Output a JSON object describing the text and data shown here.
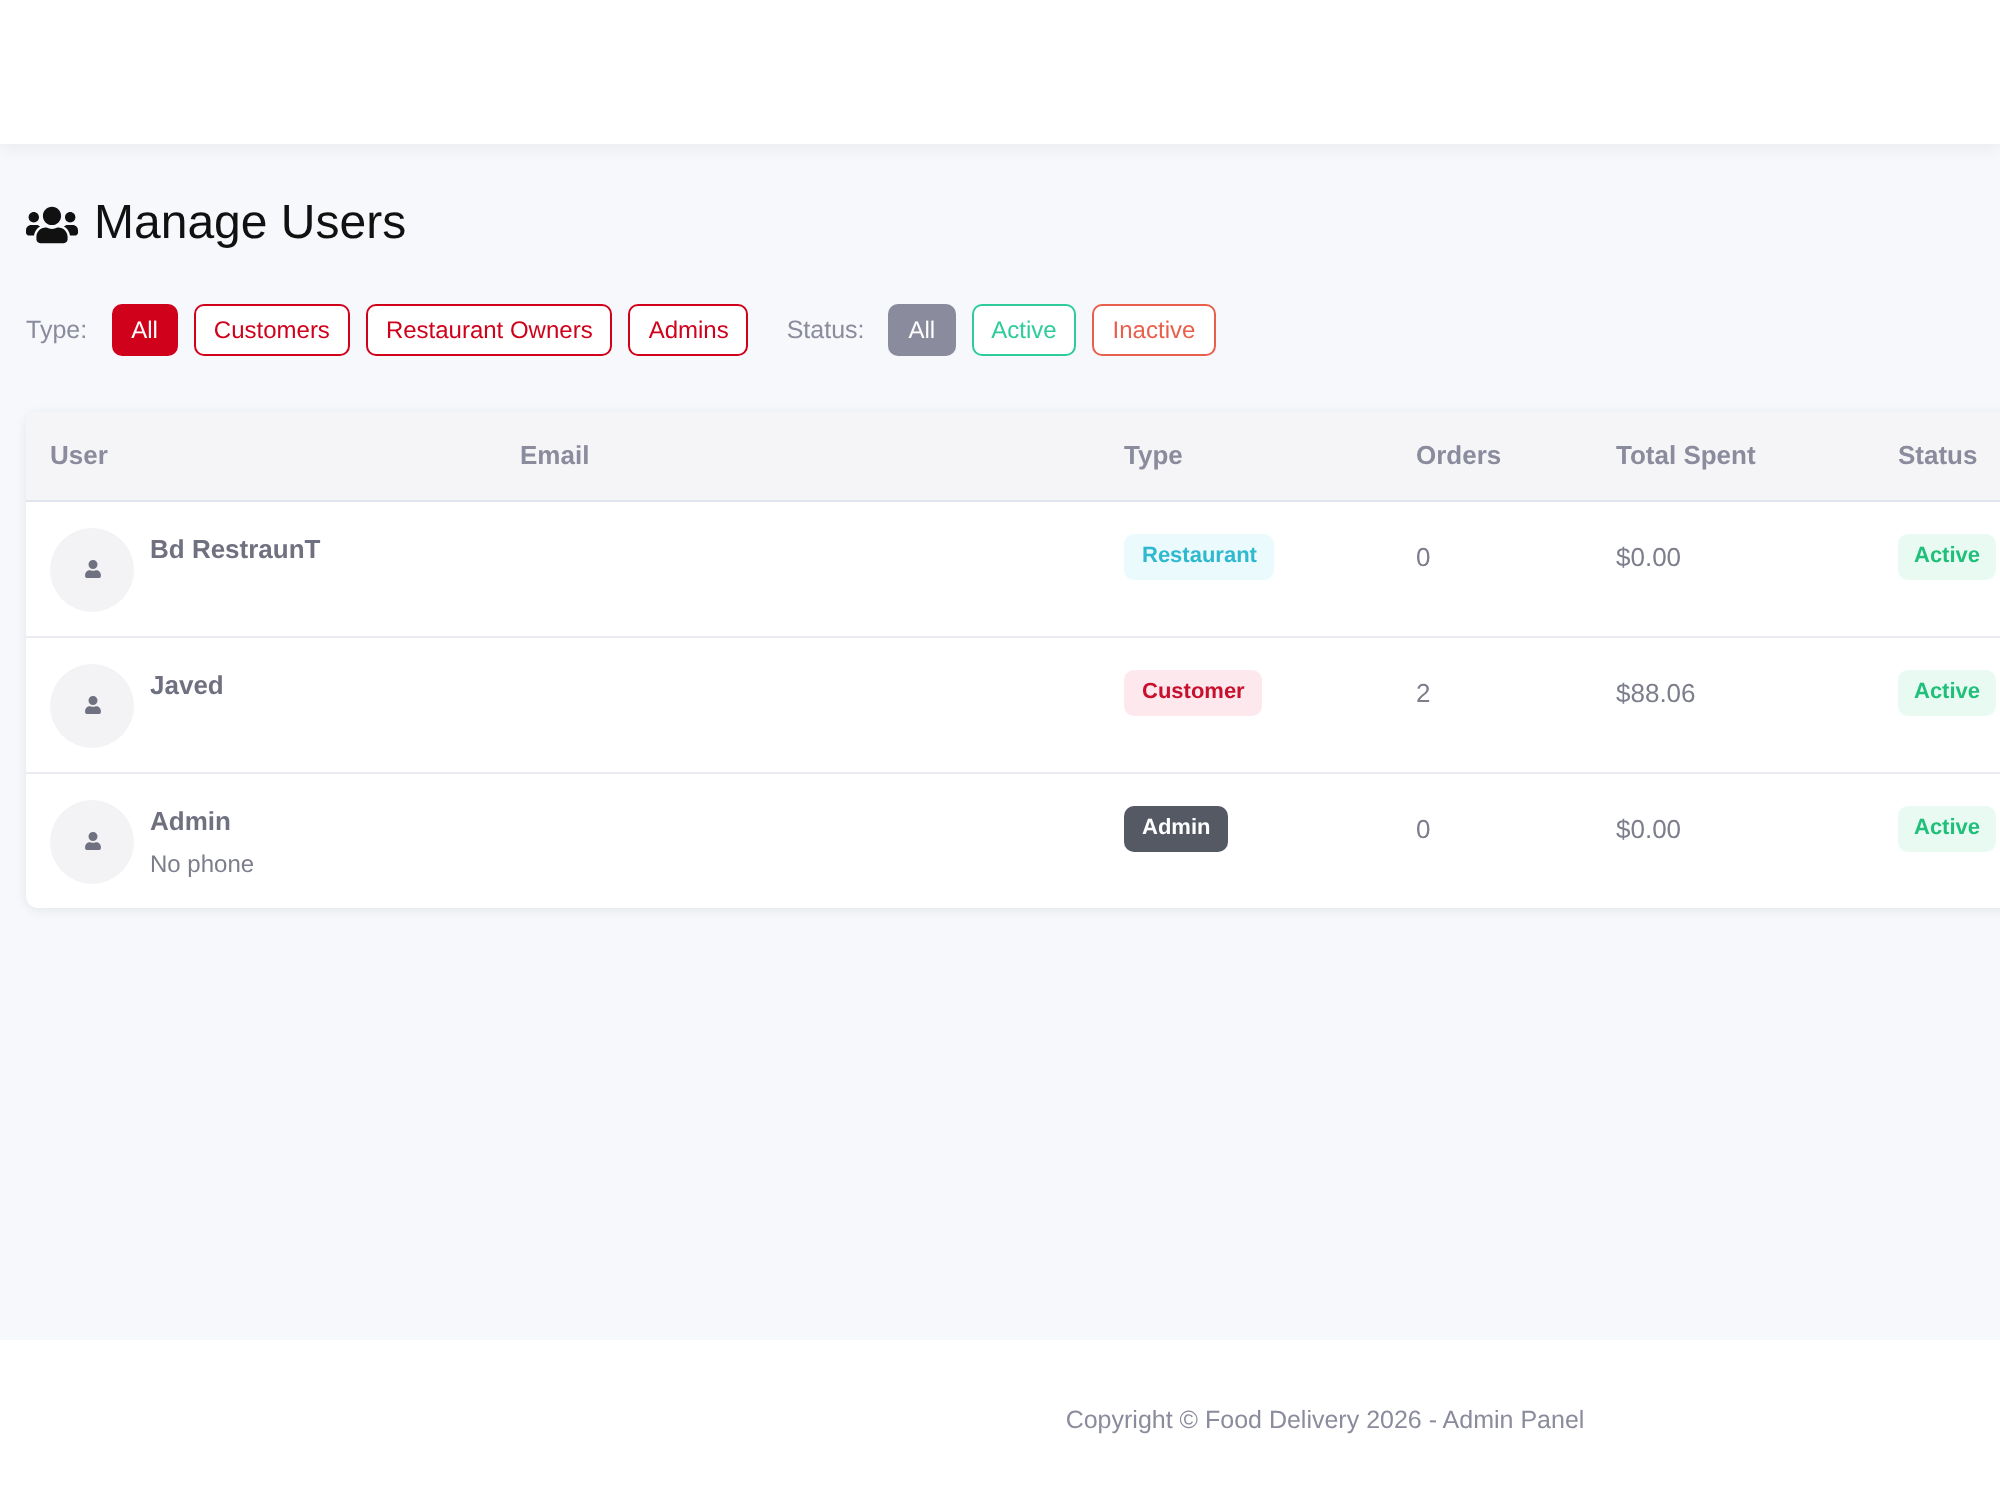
{
  "page": {
    "title": "Manage Users"
  },
  "filters": [
    {
      "label": "Type:",
      "options": [
        {
          "label": "All",
          "selected": true
        },
        {
          "label": "Customers",
          "selected": false
        },
        {
          "label": "Restaurant Owners",
          "selected": false
        },
        {
          "label": "Admins",
          "selected": false
        }
      ]
    },
    {
      "label": "Status:",
      "options": [
        {
          "label": "All",
          "selected": true,
          "color": "#8a8b9c"
        },
        {
          "label": "Active",
          "selected": false,
          "color": "#2ecc9a"
        },
        {
          "label": "Inactive",
          "selected": false,
          "color": "#e8604c"
        }
      ]
    }
  ],
  "table": {
    "columns": [
      "User",
      "Email",
      "Type",
      "Orders",
      "Total Spent",
      "Status"
    ],
    "rows": [
      {
        "user": {
          "name": "Bd RestraunT"
        },
        "type": {
          "label": "Restaurant",
          "kind": "restaurant"
        },
        "orders": "0",
        "total_spent": "$0.00",
        "status": {
          "label": "Active",
          "kind": "active"
        }
      },
      {
        "user": {
          "name": "Javed"
        },
        "type": {
          "label": "Customer",
          "kind": "customer"
        },
        "orders": "2",
        "total_spent": "$88.06",
        "status": {
          "label": "Active",
          "kind": "active"
        }
      },
      {
        "user": {
          "name": "Admin",
          "phone": "No phone"
        },
        "type": {
          "label": "Admin",
          "kind": "admin"
        },
        "orders": "0",
        "total_spent": "$0.00",
        "status": {
          "label": "Active",
          "kind": "active"
        }
      }
    ]
  },
  "footer": {
    "text": "Copyright © Food Delivery 2026 - Admin Panel"
  }
}
